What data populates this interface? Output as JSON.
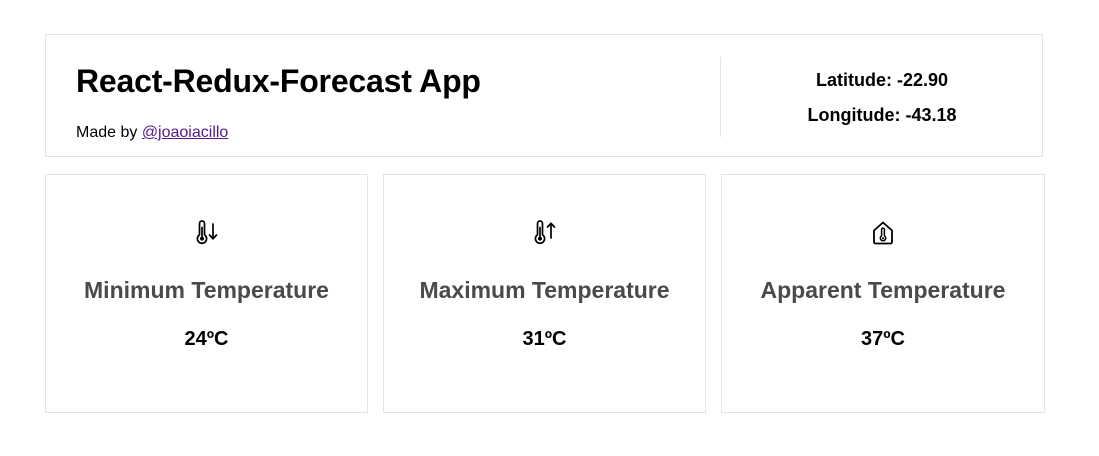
{
  "header": {
    "title": "React-Redux-Forecast App",
    "made_by_prefix": "Made by ",
    "author_link": "@joaoiacillo",
    "latitude": "Latitude: -22.90",
    "longitude": "Longitude: -43.18"
  },
  "cards": [
    {
      "icon": "thermometer-down-icon",
      "title": "Minimum Temperature",
      "value": "24ºC"
    },
    {
      "icon": "thermometer-up-icon",
      "title": "Maximum Temperature",
      "value": "31ºC"
    },
    {
      "icon": "house-thermometer-icon",
      "title": "Apparent Temperature",
      "value": "37ºC"
    }
  ],
  "colors": {
    "border": "#e4e4e4",
    "card_title": "#4a4a4a",
    "link": "#551a8b"
  }
}
